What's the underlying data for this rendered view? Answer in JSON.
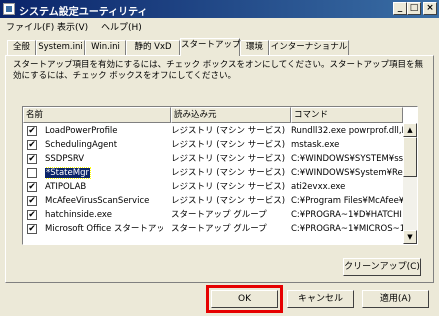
{
  "window": {
    "title": "システム設定ユーティリティ"
  },
  "window_buttons": {
    "minimize": "_",
    "maximize": "□",
    "close": "×"
  },
  "menu": [
    "ファイル(F)",
    "表示(V)",
    "ヘルプ(H)"
  ],
  "tabs": [
    "全般",
    "System.ini",
    "Win.ini",
    "静的 VxD",
    "スタートアップ",
    "環境",
    "インターナショナル"
  ],
  "active_tab": "スタートアップ",
  "description": "スタートアップ項目を有効にするには、チェック ボックスをオンにしてください。スタートアップ項目を無効にするには、チェック ボックスをオフにしてください。",
  "list": {
    "columns": [
      "名前",
      "読み込み元",
      "コマンド"
    ],
    "rows": [
      {
        "checked": "✔",
        "name": "LoadPowerProfile",
        "location": "レジストリ (マシン サービス)",
        "command": "Rundll32.exe powrprof.dll,Lo"
      },
      {
        "checked": "✔",
        "name": "SchedulingAgent",
        "location": "レジストリ (マシン サービス)",
        "command": "mstask.exe"
      },
      {
        "checked": "✔",
        "name": "SSDPSRV",
        "location": "レジストリ (マシン サービス)",
        "command": "C:¥WINDOWS¥SYSTEM¥ssc"
      },
      {
        "checked": "",
        "name": "*StateMgr",
        "location": "レジストリ (マシン サービス)",
        "command": "C:¥WINDOWS¥System¥Res"
      },
      {
        "checked": "✔",
        "name": "ATIPOLAB",
        "location": "レジストリ (マシン サービス)",
        "command": "ati2evxx.exe"
      },
      {
        "checked": "✔",
        "name": "McAfeeVirusScanService",
        "location": "レジストリ (マシン サービス)",
        "command": "C:¥Program Files¥McAfee¥"
      },
      {
        "checked": "✔",
        "name": "hatchinside.exe",
        "location": "スタートアップ グループ",
        "command": "C:¥PROGRA~1¥D¥HATCHI"
      },
      {
        "checked": "✔",
        "name": "Microsoft Office スタートアップ",
        "location": "スタートアップ グループ",
        "command": "C:¥PROGRA~1¥MICROS~1¥"
      }
    ]
  },
  "scrollbar": {
    "up": "▲",
    "down": "▼"
  },
  "buttons": {
    "cleanup": "クリーンアップ(C)",
    "ok": "OK",
    "cancel": "キャンセル",
    "apply": "適用(A)"
  },
  "colors": {
    "highlight": "#e60000",
    "titlebar": "#0a246a",
    "selection": "#0a246a"
  }
}
